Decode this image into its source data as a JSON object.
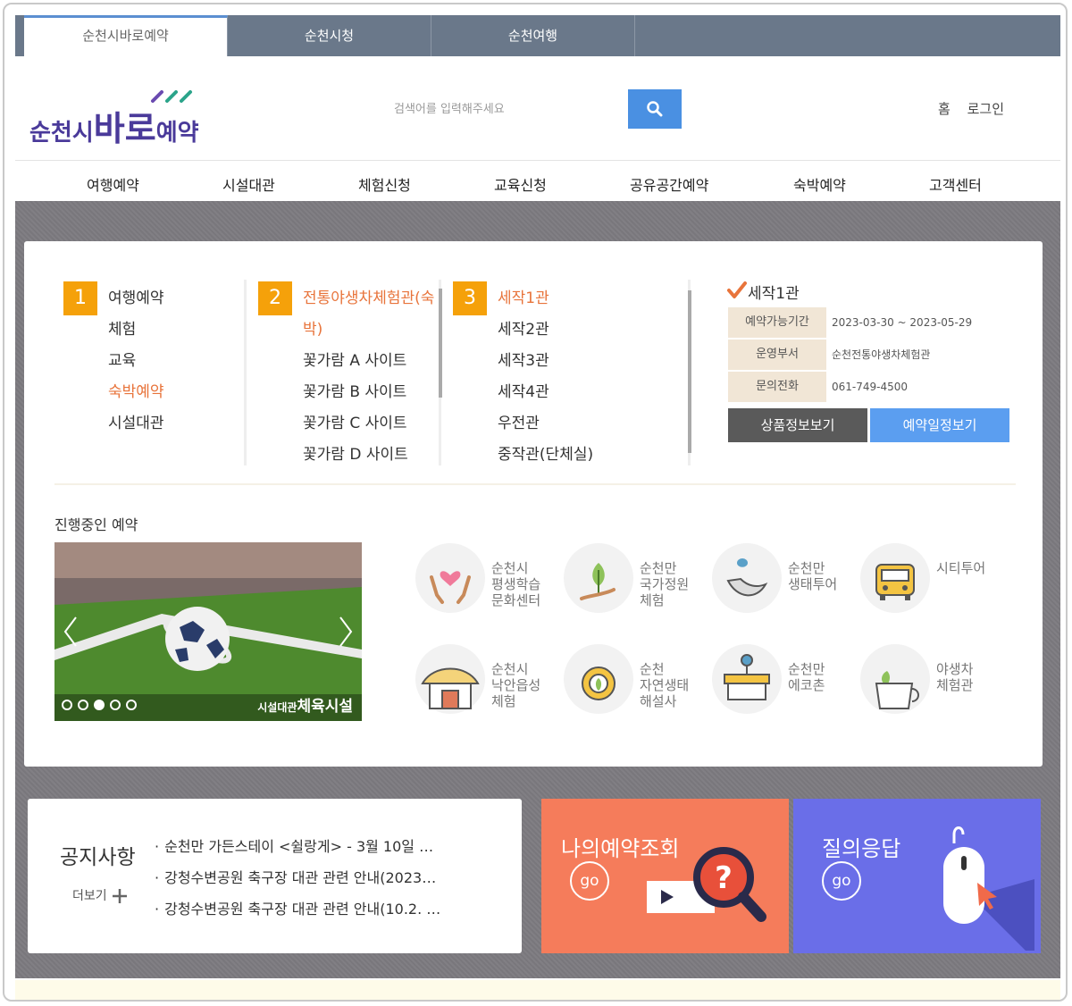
{
  "top_tabs": [
    "순천시바로예약",
    "순천시청",
    "순천여행"
  ],
  "logo": {
    "text_main": "순천시",
    "text_bold": "바로",
    "text_tail": "예약"
  },
  "search": {
    "placeholder": "검색어를 입력해주세요"
  },
  "util": {
    "home": "홈",
    "login": "로그인"
  },
  "gnb": [
    "여행예약",
    "시설대관",
    "체험신청",
    "교육신청",
    "공유공간예약",
    "숙박예약",
    "고객센터"
  ],
  "step1": {
    "num": "1",
    "items": [
      "여행예약",
      "체험",
      "교육",
      "숙박예약",
      "시설대관"
    ],
    "selected": "숙박예약"
  },
  "step2": {
    "num": "2",
    "items": [
      "전통야생차체험관(숙",
      "박)",
      "꽃가람 A 사이트",
      "꽃가람 B 사이트",
      "꽃가람 C 사이트",
      "꽃가람 D 사이트"
    ]
  },
  "step3": {
    "num": "3",
    "items": [
      "세작1관",
      "세작2관",
      "세작3관",
      "세작4관",
      "우전관",
      "중작관(단체실)"
    ]
  },
  "info": {
    "title": "세작1관",
    "rows": [
      {
        "label": "예약가능기간",
        "value": "2023-03-30 ~ 2023-05-29"
      },
      {
        "label": "운영부서",
        "value": "순천전통야생차체험관"
      },
      {
        "label": "문의전화",
        "value": "061-749-4500"
      }
    ],
    "btn_product": "상품정보보기",
    "btn_schedule": "예약일정보기"
  },
  "ongoing": {
    "title": "진행중인 예약",
    "slide_caption_small": "시설대관",
    "slide_caption": "체육시설",
    "slide_count": 5,
    "slide_active": 3
  },
  "quick": [
    {
      "label": "순천시\n평생학습\n문화센터",
      "icon": "hands-heart-icon"
    },
    {
      "label": "순천만\n국가정원\n체험",
      "icon": "plant-hand-icon"
    },
    {
      "label": "순천만\n생태투어",
      "icon": "bird-icon"
    },
    {
      "label": "시티투어",
      "icon": "bus-icon"
    },
    {
      "label": "순천시\n낙안읍성\n체험",
      "icon": "thatched-house-icon"
    },
    {
      "label": "순천\n자연생태\n해설사",
      "icon": "gear-leaf-icon"
    },
    {
      "label": "순천만\n에코촌",
      "icon": "stall-icon"
    },
    {
      "label": "야생차\n체험관",
      "icon": "tea-cup-icon"
    }
  ],
  "notice": {
    "title": "공지사항",
    "more": "더보기",
    "items": [
      "순천만 가든스테이 <쉴랑게> - 3월 10일 …",
      "강청수변공원 축구장 대관 관련 안내(2023…",
      "강청수변공원 축구장 대관 관련 안내(10.2. …"
    ]
  },
  "banners": {
    "my_reservation": "나의예약조회",
    "qna": "질의응답",
    "go": "go"
  },
  "colors": {
    "accent_orange": "#f5a10a",
    "selected_text": "#e8743b",
    "top_bar": "#6a788a",
    "search_btn": "#4a90e2"
  }
}
